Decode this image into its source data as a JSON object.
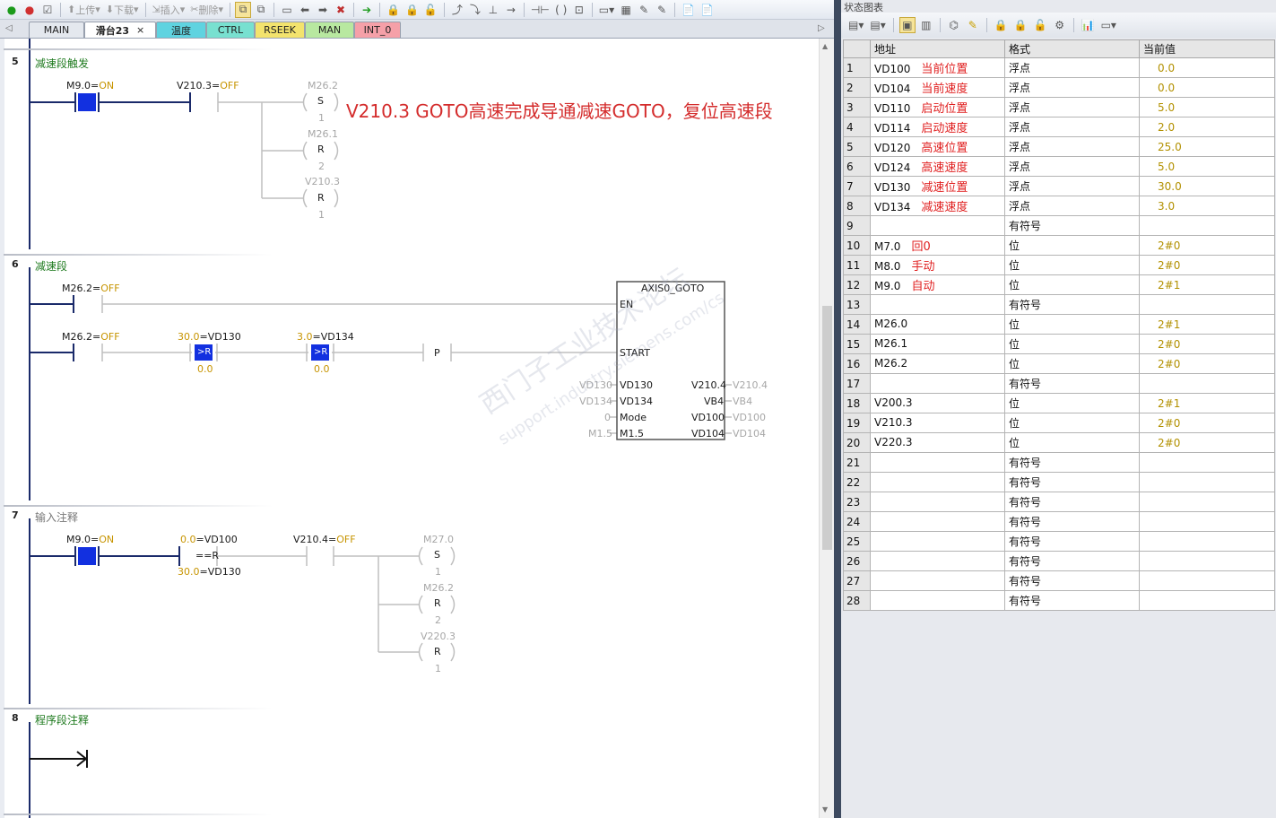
{
  "toolbar": {
    "upload_label": "上传",
    "download_label": "下载",
    "insert_label": "插入",
    "delete_label": "删除"
  },
  "tabs": [
    {
      "label": "MAIN",
      "color": "#e4e8ee"
    },
    {
      "label": "滑台23",
      "color": "#ffffff"
    },
    {
      "label": "温度",
      "color": "#5fd3e0"
    },
    {
      "label": "CTRL",
      "color": "#78e0d0"
    },
    {
      "label": "RSEEK",
      "color": "#f3e36d"
    },
    {
      "label": "MAN",
      "color": "#b8e8a0"
    },
    {
      "label": "INT_0",
      "color": "#f5a0a8"
    }
  ],
  "tab_close": "×",
  "networks": {
    "n5": {
      "number": "5",
      "title": "减速段触发",
      "c1_addr": "M9.0",
      "c1_state": "ON",
      "c2_addr": "V210.3",
      "c2_state": "OFF",
      "coil1_addr": "M26.2",
      "coil1_type": "S",
      "coil1_n": "1",
      "coil2_addr": "M26.1",
      "coil2_type": "R",
      "coil2_n": "2",
      "coil3_addr": "V210.3",
      "coil3_type": "R",
      "coil3_n": "1",
      "annotation": "V210.3 GOTO高速完成导通减速GOTO，复位高速段"
    },
    "n6": {
      "number": "6",
      "title": "减速段",
      "c1_addr": "M26.2",
      "c1_state": "OFF",
      "c2_addr": "M26.2",
      "c2_state": "OFF",
      "cmp1_top_val": "30.0",
      "cmp1_top_addr": "VD130",
      "cmp1_op": ">R",
      "cmp1_bot": "0.0",
      "cmp2_top_val": "3.0",
      "cmp2_top_addr": "VD134",
      "cmp2_op": ">R",
      "cmp2_bot": "0.0",
      "p_label": "P",
      "box_title": "AXIS0_GOTO",
      "pin_en": "EN",
      "pin_start": "START",
      "in1_pin": "VD130",
      "in1_val": "VD130",
      "in2_pin": "VD134",
      "in2_val": "VD134",
      "in3_pin": "Mode",
      "in3_val": "0",
      "in4_pin": "M1.5",
      "in4_val": "M1.5",
      "out1_pin": "V210.4",
      "out1_val": "V210.4",
      "out2_pin": "VB4",
      "out2_val": "VB4",
      "out3_pin": "VD100",
      "out3_val": "VD100",
      "out4_pin": "VD104",
      "out4_val": "VD104"
    },
    "n7": {
      "number": "7",
      "title": "输入注释",
      "c1_addr": "M9.0",
      "c1_state": "ON",
      "cmp_top_val": "0.0",
      "cmp_top_addr": "VD100",
      "cmp_op": "==R",
      "cmp_bot_val": "30.0",
      "cmp_bot_addr": "VD130",
      "c3_addr": "V210.4",
      "c3_state": "OFF",
      "coil1_addr": "M27.0",
      "coil1_type": "S",
      "coil1_n": "1",
      "coil2_addr": "M26.2",
      "coil2_type": "R",
      "coil2_n": "2",
      "coil3_addr": "V220.3",
      "coil3_type": "R",
      "coil3_n": "1"
    },
    "n8": {
      "number": "8",
      "title": "程序段注释"
    }
  },
  "watermark": {
    "line1": "西门子工业技术论坛",
    "line2": "support.industry.siemens.com/cs"
  },
  "status_chart": {
    "title": "状态图表",
    "headers": [
      "",
      "地址",
      "格式",
      "当前值"
    ],
    "rows": [
      {
        "n": "1",
        "addr": "VD100",
        "comment": "当前位置",
        "fmt": "浮点",
        "val": "0.0"
      },
      {
        "n": "2",
        "addr": "VD104",
        "comment": "当前速度",
        "fmt": "浮点",
        "val": "0.0"
      },
      {
        "n": "3",
        "addr": "VD110",
        "comment": "启动位置",
        "fmt": "浮点",
        "val": "5.0"
      },
      {
        "n": "4",
        "addr": "VD114",
        "comment": "启动速度",
        "fmt": "浮点",
        "val": "2.0"
      },
      {
        "n": "5",
        "addr": "VD120",
        "comment": "高速位置",
        "fmt": "浮点",
        "val": "25.0"
      },
      {
        "n": "6",
        "addr": "VD124",
        "comment": "高速速度",
        "fmt": "浮点",
        "val": "5.0"
      },
      {
        "n": "7",
        "addr": "VD130",
        "comment": "减速位置",
        "fmt": "浮点",
        "val": "30.0"
      },
      {
        "n": "8",
        "addr": "VD134",
        "comment": "减速速度",
        "fmt": "浮点",
        "val": "3.0"
      },
      {
        "n": "9",
        "addr": "",
        "comment": "",
        "fmt": "有符号",
        "val": ""
      },
      {
        "n": "10",
        "addr": "M7.0",
        "comment": "回0",
        "fmt": "位",
        "val": "2#0"
      },
      {
        "n": "11",
        "addr": "M8.0",
        "comment": "手动",
        "fmt": "位",
        "val": "2#0"
      },
      {
        "n": "12",
        "addr": "M9.0",
        "comment": "自动",
        "fmt": "位",
        "val": "2#1"
      },
      {
        "n": "13",
        "addr": "",
        "comment": "",
        "fmt": "有符号",
        "val": ""
      },
      {
        "n": "14",
        "addr": "M26.0",
        "comment": "",
        "fmt": "位",
        "val": "2#1"
      },
      {
        "n": "15",
        "addr": "M26.1",
        "comment": "",
        "fmt": "位",
        "val": "2#0"
      },
      {
        "n": "16",
        "addr": "M26.2",
        "comment": "",
        "fmt": "位",
        "val": "2#0"
      },
      {
        "n": "17",
        "addr": "",
        "comment": "",
        "fmt": "有符号",
        "val": ""
      },
      {
        "n": "18",
        "addr": "V200.3",
        "comment": "",
        "fmt": "位",
        "val": "2#1"
      },
      {
        "n": "19",
        "addr": "V210.3",
        "comment": "",
        "fmt": "位",
        "val": "2#0"
      },
      {
        "n": "20",
        "addr": "V220.3",
        "comment": "",
        "fmt": "位",
        "val": "2#0"
      },
      {
        "n": "21",
        "addr": "",
        "comment": "",
        "fmt": "有符号",
        "val": ""
      },
      {
        "n": "22",
        "addr": "",
        "comment": "",
        "fmt": "有符号",
        "val": ""
      },
      {
        "n": "23",
        "addr": "",
        "comment": "",
        "fmt": "有符号",
        "val": ""
      },
      {
        "n": "24",
        "addr": "",
        "comment": "",
        "fmt": "有符号",
        "val": ""
      },
      {
        "n": "25",
        "addr": "",
        "comment": "",
        "fmt": "有符号",
        "val": ""
      },
      {
        "n": "26",
        "addr": "",
        "comment": "",
        "fmt": "有符号",
        "val": ""
      },
      {
        "n": "27",
        "addr": "",
        "comment": "",
        "fmt": "有符号",
        "val": ""
      },
      {
        "n": "28",
        "addr": "",
        "comment": "",
        "fmt": "有符号",
        "val": ""
      }
    ]
  },
  "colors": {
    "energized": "#1230e0",
    "rail": "#1a2a6a",
    "state": "#c79400",
    "comment": "#e02020"
  }
}
